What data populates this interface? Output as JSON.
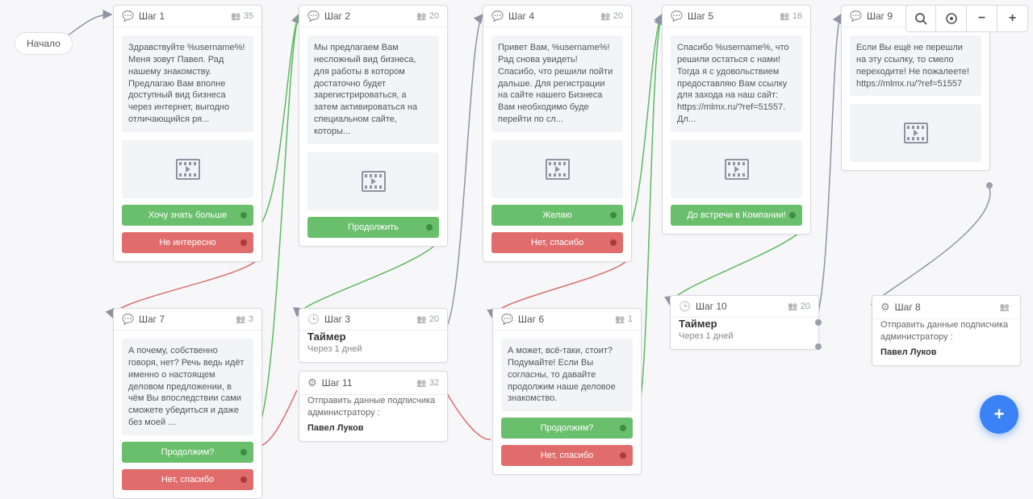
{
  "start": {
    "label": "Начало"
  },
  "toolbar": {
    "search": "search",
    "target": "target",
    "minus": "−",
    "plus": "+"
  },
  "fab": {
    "label": "+"
  },
  "common": {
    "timer_title": "Таймер",
    "timer_sub": "Через 1 дней",
    "admin_text": "Отправить данные подписчика администратору :",
    "admin_name": "Павел Луков"
  },
  "steps": {
    "s1": {
      "title": "Шаг 1",
      "count": "35",
      "msg": "Здравствуйте %username%! Меня зовут Павел. Рад нашему знакомству. Предлагаю Вам вполне доступный вид бизнеса через интернет, выгодно отличающийся ря...",
      "btn1": "Хочу знать больше",
      "btn2": "Не интересно"
    },
    "s2": {
      "title": "Шаг 2",
      "count": "20",
      "msg": "Мы предлагаем Вам несложный вид бизнеса, для работы в котором достаточно будет зарегистрироваться, а затем активироваться на специальном сайте, которы...",
      "btn1": "Продолжить"
    },
    "s4": {
      "title": "Шаг 4",
      "count": "20",
      "msg": "Привет Вам, %username%! Рад снова увидеть! Спасибо, что решили пойти дальше. Для регистрации на сайте нашего Бизнеса Вам необходимо буде перейти по сл...",
      "btn1": "Желаю",
      "btn2": "Нет, спасибо"
    },
    "s5": {
      "title": "Шаг 5",
      "count": "16",
      "msg": "Спасибо %username%, что решили остаться с нами! Тогда я с удовольствием предоставляю Вам ссылку для захода на наш сайт: https://mlmx.ru/?ref=51557. Дл...",
      "btn1": "До встречи в Компании!"
    },
    "s9": {
      "title": "Шаг 9",
      "count": "",
      "msg": "Если Вы ещё не перешли на эту ссылку, то смело переходите! Не пожалеете! https://mlmx.ru/?ref=51557"
    },
    "s7": {
      "title": "Шаг 7",
      "count": "3",
      "msg": "А почему, собственно говоря, нет? Речь ведь идёт именно о настоящем деловом предложении, в чём Вы впоследствии сами сможете убедиться и даже без моей ...",
      "btn1": "Продолжим?",
      "btn2": "Нет, спасибо"
    },
    "s3": {
      "title": "Шаг 3",
      "count": "20"
    },
    "s11": {
      "title": "Шаг 11",
      "count": "32"
    },
    "s6": {
      "title": "Шаг 6",
      "count": "1",
      "msg": "А может, всё-таки, стоит? Подумайте! Если Вы согласны, то давайте продолжим наше деловое знакомство.",
      "btn1": "Продолжим?",
      "btn2": "Нет, спасибо"
    },
    "s10": {
      "title": "Шаг 10",
      "count": "20"
    },
    "s8": {
      "title": "Шаг 8",
      "count": ""
    }
  }
}
